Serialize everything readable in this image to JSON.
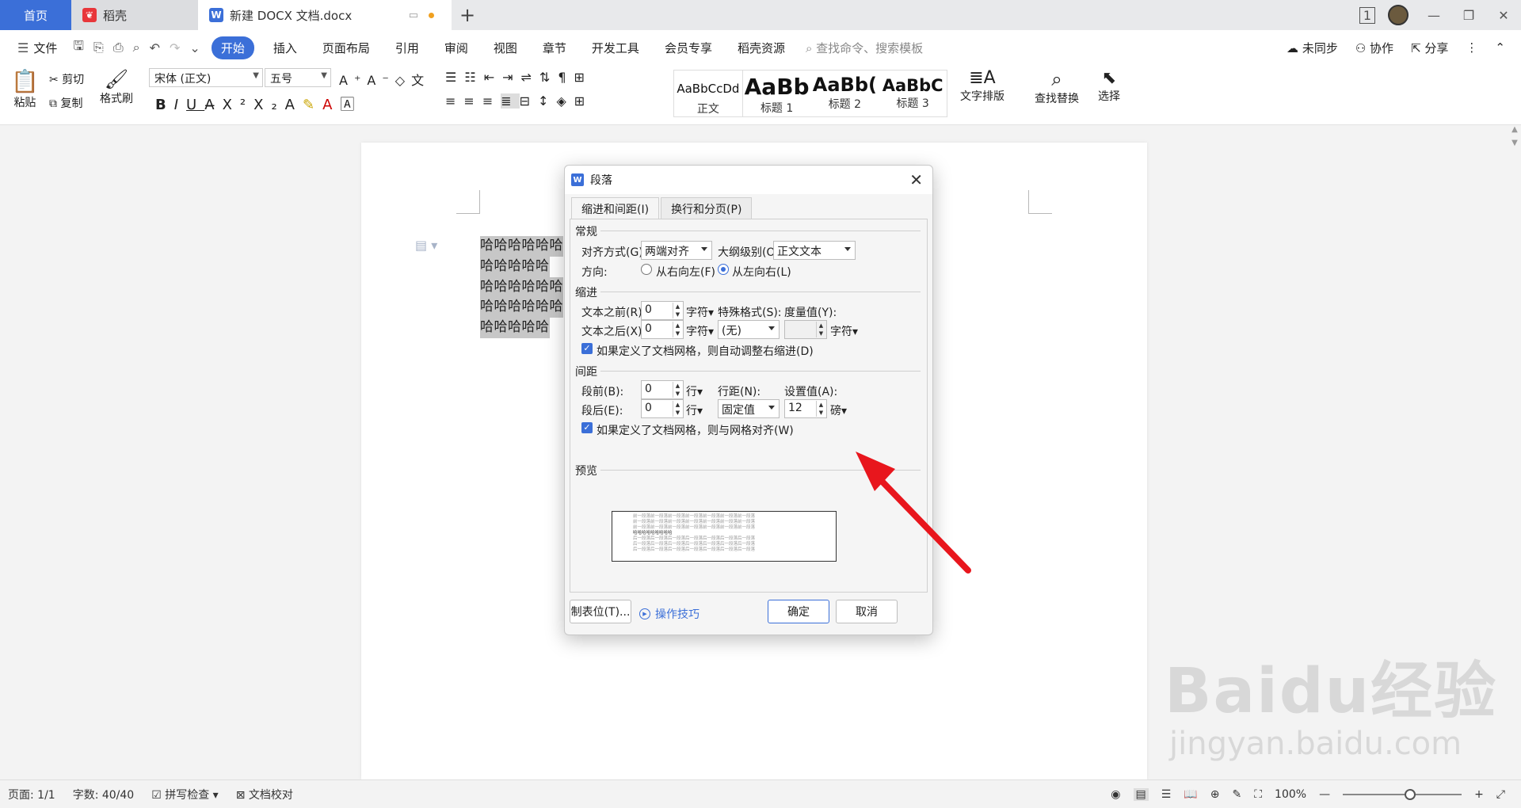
{
  "tabs": {
    "home": "首页",
    "daoke": "稻壳",
    "doc": "新建 DOCX 文档.docx",
    "new_tab": "+"
  },
  "window": {
    "badge": "1"
  },
  "menu": {
    "file": "文件",
    "items": [
      "开始",
      "插入",
      "页面布局",
      "引用",
      "审阅",
      "视图",
      "章节",
      "开发工具",
      "会员专享",
      "稻壳资源"
    ],
    "search_placeholder": "查找命令、搜索模板",
    "unsynced": "未同步",
    "collab": "协作",
    "share": "分享"
  },
  "ribbon": {
    "paste": "粘贴",
    "cut": "剪切",
    "copy": "复制",
    "format_painter": "格式刷",
    "font_name": "宋体 (正文)",
    "font_size": "五号",
    "styles": [
      {
        "sample": "AaBbCcDd",
        "name": "正文"
      },
      {
        "sample": "AaBb",
        "name": "标题 1"
      },
      {
        "sample": "AaBb(",
        "name": "标题 2"
      },
      {
        "sample": "AaBbC",
        "name": "标题 3"
      }
    ],
    "text_layout": "文字排版",
    "find_replace": "查找替换",
    "select": "选择"
  },
  "document": {
    "lines": [
      "哈哈哈哈哈哈",
      "哈哈哈哈哈",
      "哈哈哈哈哈哈",
      "哈哈哈哈哈哈",
      "哈哈哈哈哈"
    ]
  },
  "dialog": {
    "title": "段落",
    "tab_indent": "缩进和间距(I)",
    "tab_linebreak": "换行和分页(P)",
    "general": "常规",
    "align_label": "对齐方式(G):",
    "align_value": "两端对齐",
    "outline_label": "大纲级别(O):",
    "outline_value": "正文文本",
    "direction_label": "方向:",
    "rtl": "从右向左(F)",
    "ltr": "从左向右(L)",
    "indent": "缩进",
    "before_text_label": "文本之前(R):",
    "before_text_value": "0",
    "after_text_label": "文本之后(X):",
    "after_text_value": "0",
    "unit_char": "字符",
    "special_label": "特殊格式(S):",
    "special_value": "(无)",
    "measure_label": "度量值(Y):",
    "measure_value": "",
    "auto_indent_check": "如果定义了文档网格，则自动调整右缩进(D)",
    "spacing": "间距",
    "before_para_label": "段前(B):",
    "before_para_value": "0",
    "after_para_label": "段后(E):",
    "after_para_value": "0",
    "unit_line": "行",
    "line_spacing_label": "行距(N):",
    "line_spacing_value": "固定值",
    "set_value_label": "设置值(A):",
    "set_value": "12",
    "unit_pound": "磅",
    "grid_align_check": "如果定义了文档网格，则与网格对齐(W)",
    "preview": "预览",
    "preview_prev": "前一段落前一段落前一段落前一段落前一段落前一段落前一段落",
    "preview_cur": "哈哈哈哈哈哈哈哈哈",
    "preview_next": "后一段落后一段落后一段落后一段落后一段落后一段落后一段落",
    "tabs_button": "制表位(T)...",
    "tips": "操作技巧",
    "ok": "确定",
    "cancel": "取消"
  },
  "status": {
    "page": "页面: 1/1",
    "words": "字数: 40/40",
    "spell": "拼写检查",
    "proof": "文档校对",
    "zoom": "100%"
  },
  "watermark": {
    "brand": "Baidu经验",
    "url": "jingyan.baidu.com"
  },
  "colors": {
    "accent": "#3b6fd8",
    "arrow": "#e8161d",
    "selection": "#c7c7c7"
  }
}
